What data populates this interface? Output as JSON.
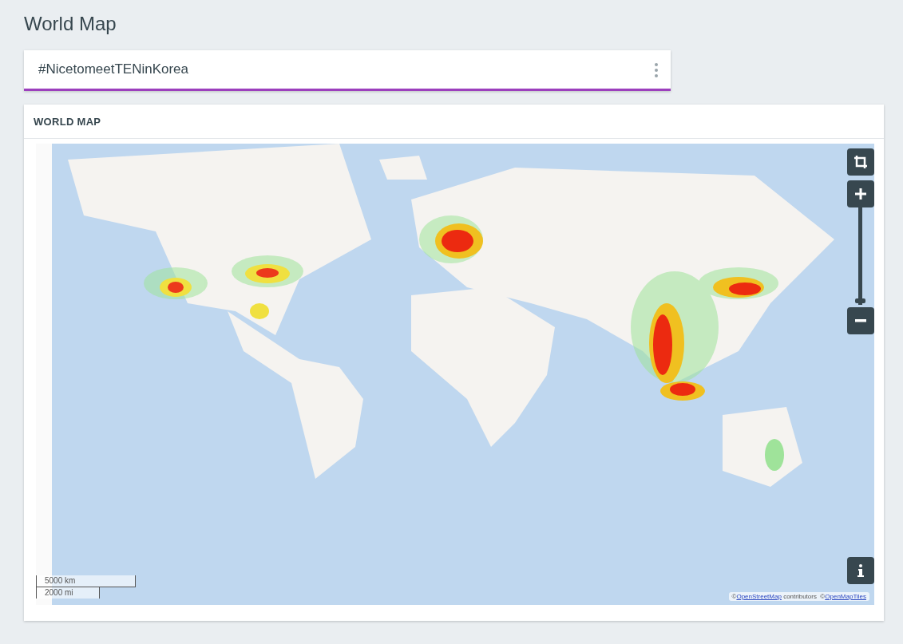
{
  "page": {
    "title": "World Map"
  },
  "filter": {
    "value": "#NicetomeetTENinKorea"
  },
  "panel": {
    "title": "WORLD MAP",
    "map": {
      "kind": "picture",
      "zoom_slider": {
        "level": 0.02
      },
      "scale": [
        "5000 km",
        "2000 mi"
      ],
      "attribution": [
        {
          "kind": "text",
          "text": "©"
        },
        {
          "kind": "link",
          "text": "OpenStreetMap"
        },
        {
          "kind": "text",
          "text": " contributors  ©"
        },
        {
          "kind": "link",
          "text": "OpenMapTiles"
        }
      ]
    }
  }
}
